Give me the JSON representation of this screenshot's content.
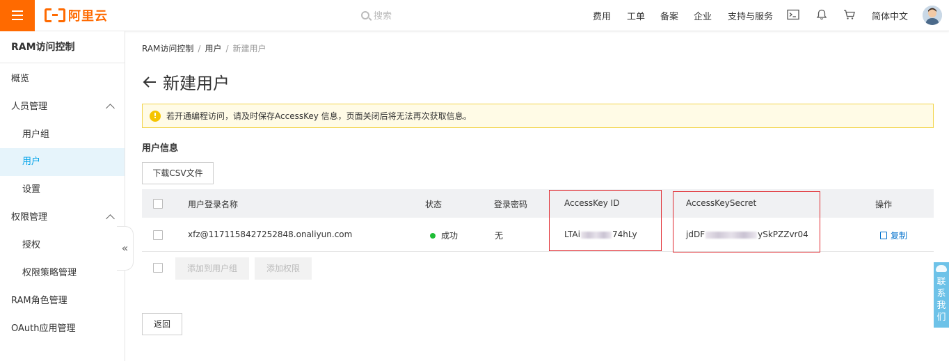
{
  "header": {
    "brand": "阿里云",
    "search_placeholder": "搜索",
    "nav": [
      "费用",
      "工单",
      "备案",
      "企业",
      "支持与服务"
    ],
    "language": "简体中文"
  },
  "sidebar": {
    "title": "RAM访问控制",
    "items": [
      {
        "label": "概览"
      },
      {
        "label": "人员管理"
      },
      {
        "label": "用户组"
      },
      {
        "label": "用户"
      },
      {
        "label": "设置"
      },
      {
        "label": "权限管理"
      },
      {
        "label": "授权"
      },
      {
        "label": "权限策略管理"
      },
      {
        "label": "RAM角色管理"
      },
      {
        "label": "OAuth应用管理"
      }
    ],
    "collapse_glyph": "«"
  },
  "breadcrumb": [
    "RAM访问控制",
    "用户",
    "新建用户"
  ],
  "page": {
    "title": "新建用户",
    "alert": "若开通编程访问，请及时保存AccessKey 信息，页面关闭后将无法再次获取信息。",
    "section_title": "用户信息",
    "download_csv": "下载CSV文件",
    "back_button": "返回"
  },
  "table": {
    "headers": [
      "用户登录名称",
      "状态",
      "登录密码",
      "AccessKey ID",
      "AccessKeySecret",
      "操作"
    ],
    "rows": [
      {
        "login_name": "xfz@1171158427252848.onaliyun.com",
        "status": "成功",
        "password": "无",
        "access_key_id_prefix": "LTAi",
        "access_key_id_suffix": "74hLy",
        "access_key_secret_prefix": "jdDF",
        "access_key_secret_suffix": "ySkPZZvr04",
        "action": "复制"
      }
    ],
    "bulk_actions": [
      "添加到用户组",
      "添加权限"
    ]
  },
  "contact": [
    "联",
    "系",
    "我",
    "们"
  ],
  "colors": {
    "brand_orange": "#ff6a00",
    "active_blue": "#00a2e9",
    "link_blue": "#0070cc",
    "highlight_red": "#e0252b",
    "success_green": "#1fbd36",
    "alert_bg": "#fffbe6"
  }
}
